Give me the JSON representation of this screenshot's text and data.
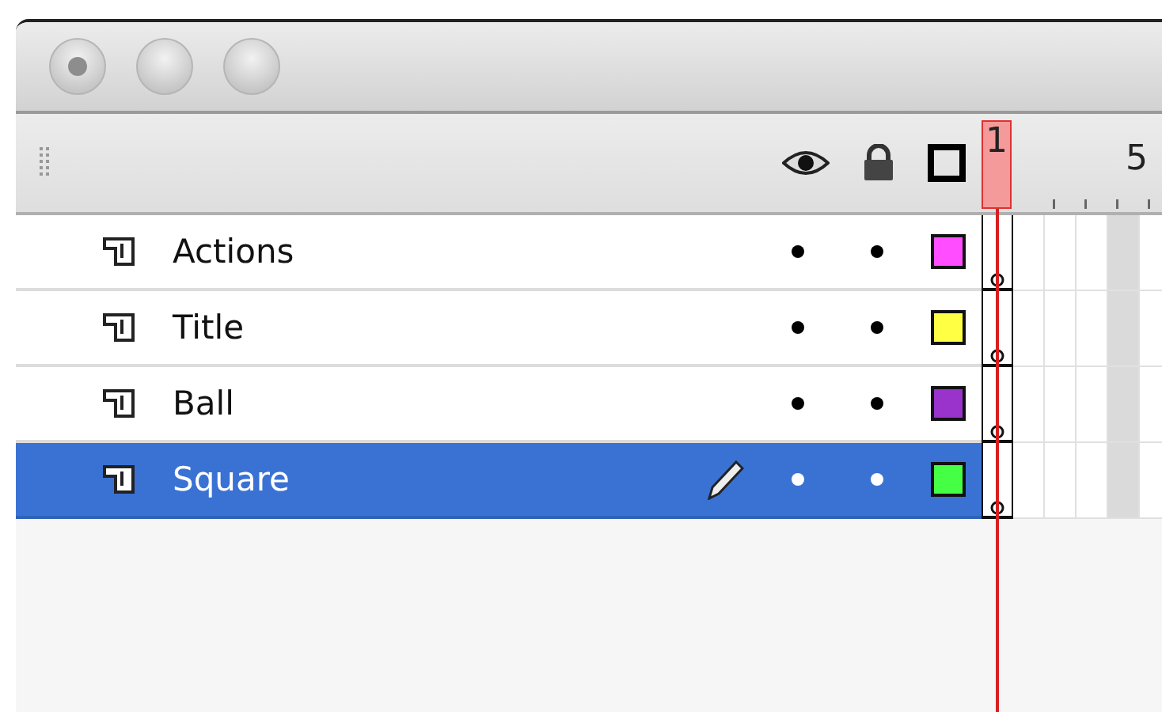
{
  "timeline_header": {
    "playhead_frame": "1",
    "frame_label": "5"
  },
  "layers": [
    {
      "name": "Actions",
      "selected": false,
      "editing": false,
      "color": "#ff4dff"
    },
    {
      "name": "Title",
      "selected": false,
      "editing": false,
      "color": "#ffff44"
    },
    {
      "name": "Ball",
      "selected": false,
      "editing": false,
      "color": "#9933cc"
    },
    {
      "name": "Square",
      "selected": true,
      "editing": true,
      "color": "#44ff44"
    }
  ]
}
